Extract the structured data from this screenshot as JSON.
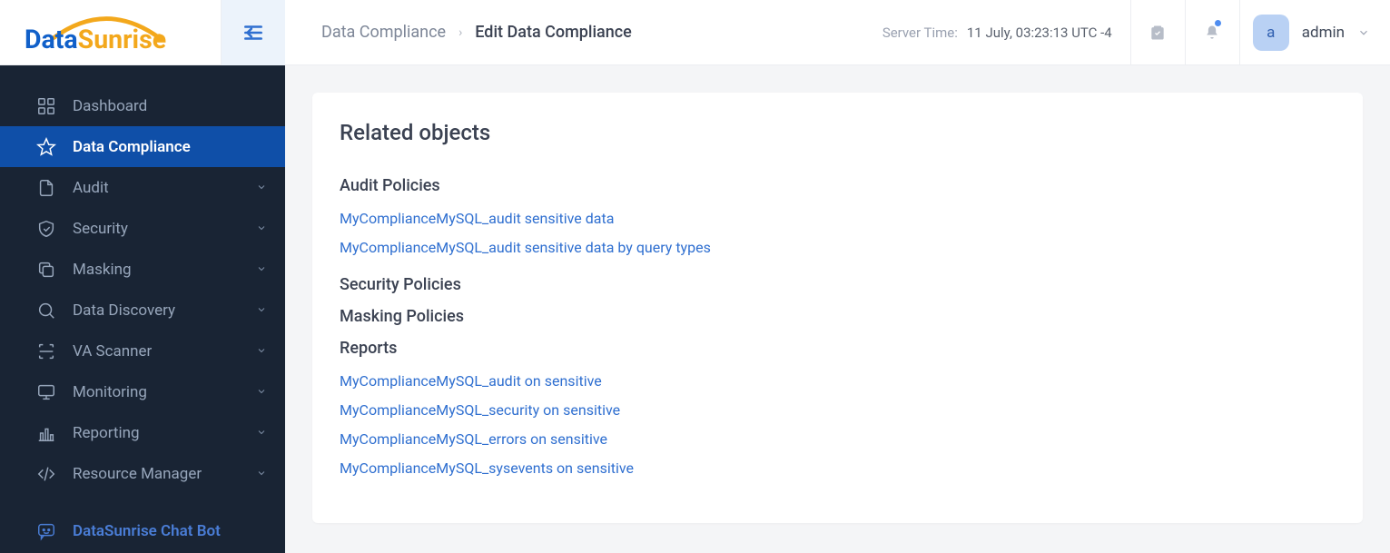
{
  "logo": {
    "word1": "Data",
    "word2": "Sunrise"
  },
  "header": {
    "breadcrumb_root": "Data Compliance",
    "breadcrumb_current": "Edit Data Compliance",
    "server_time_label": "Server Time:",
    "server_time_value": "11 July, 03:23:13  UTC -4",
    "avatar_letter": "a",
    "username": "admin"
  },
  "sidebar": {
    "items": [
      {
        "label": "Dashboard",
        "icon": "grid",
        "active": false,
        "expandable": false
      },
      {
        "label": "Data Compliance",
        "icon": "star",
        "active": true,
        "expandable": false
      },
      {
        "label": "Audit",
        "icon": "file",
        "active": false,
        "expandable": true
      },
      {
        "label": "Security",
        "icon": "shield",
        "active": false,
        "expandable": true
      },
      {
        "label": "Masking",
        "icon": "copy",
        "active": false,
        "expandable": true
      },
      {
        "label": "Data Discovery",
        "icon": "search",
        "active": false,
        "expandable": true
      },
      {
        "label": "VA Scanner",
        "icon": "scan",
        "active": false,
        "expandable": true
      },
      {
        "label": "Monitoring",
        "icon": "monitor",
        "active": false,
        "expandable": true
      },
      {
        "label": "Reporting",
        "icon": "barchart",
        "active": false,
        "expandable": true
      },
      {
        "label": "Resource Manager",
        "icon": "code",
        "active": false,
        "expandable": true
      }
    ],
    "chatbot_label": "DataSunrise Chat Bot"
  },
  "content": {
    "title": "Related objects",
    "sections": [
      {
        "title": "Audit Policies",
        "links": [
          "MyComplianceMySQL_audit sensitive data",
          "MyComplianceMySQL_audit sensitive data by query types"
        ]
      },
      {
        "title": "Security Policies",
        "links": []
      },
      {
        "title": "Masking Policies",
        "links": []
      },
      {
        "title": "Reports",
        "links": [
          "MyComplianceMySQL_audit on sensitive",
          "MyComplianceMySQL_security on sensitive",
          "MyComplianceMySQL_errors on sensitive",
          "MyComplianceMySQL_sysevents on sensitive"
        ]
      }
    ]
  }
}
